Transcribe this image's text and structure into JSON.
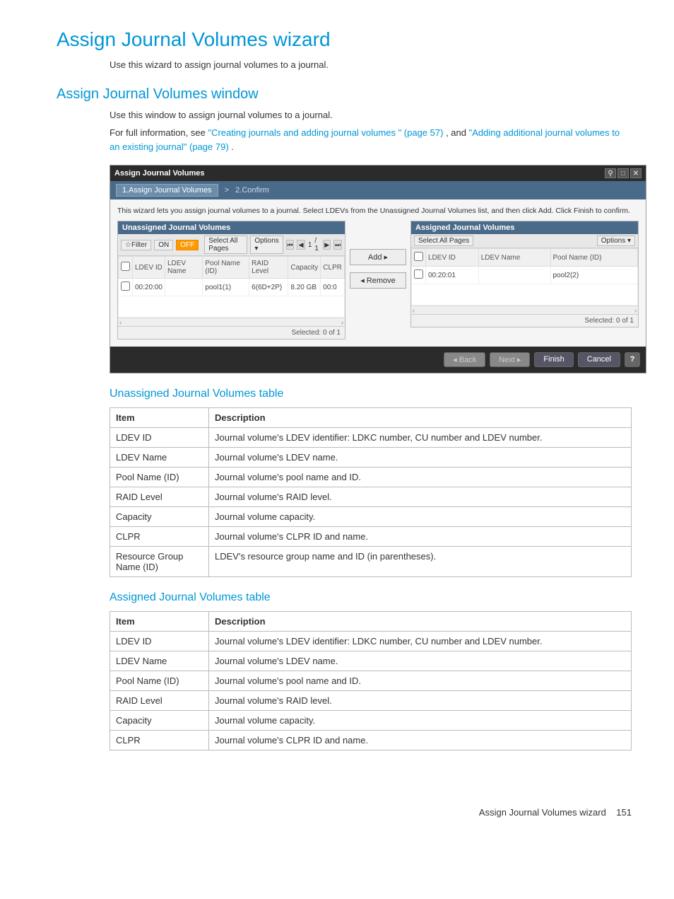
{
  "page": {
    "main_title": "Assign Journal Volumes wizard",
    "intro": "Use this wizard to assign journal volumes to a journal.",
    "section2_title": "Assign Journal Volumes window",
    "section2_intro": "Use this window to assign journal volumes to a journal.",
    "full_info_prefix": "For full information, see ",
    "link1": "\"Creating journals and adding journal volumes \" (page 57)",
    "mid_text": ", and ",
    "link2": "\"Adding additional journal volumes to an existing journal\" (page 79)",
    "end_punct": "."
  },
  "wizard": {
    "title": "Assign Journal Volumes",
    "breadcrumb_step1": "1.Assign Journal Volumes",
    "breadcrumb_sep": ">",
    "breadcrumb_step2": "2.Confirm",
    "instruction": "This wizard lets you assign journal volumes to a journal. Select LDEVs from the Unassigned Journal Volumes list, and then click Add. Click Finish to confirm.",
    "left_panel": {
      "header": "Unassigned Journal Volumes",
      "filter_label": "☆Filter",
      "on": "ON",
      "off": "OFF",
      "select_all": "Select All Pages",
      "options": "Options ▾",
      "page_cur": "1",
      "page_sep": "/ 1",
      "columns": [
        "LDEV ID",
        "LDEV Name",
        "Pool Name (ID)",
        "RAID Level",
        "Capacity",
        "CLPR"
      ],
      "row": [
        "00:20:00",
        "",
        "pool1(1)",
        "6(6D+2P)",
        "8.20 GB",
        "00:0"
      ],
      "selected": "Selected:  0   of  1"
    },
    "right_panel": {
      "header": "Assigned Journal Volumes",
      "select_all": "Select All Pages",
      "options": "Options ▾",
      "columns": [
        "LDEV ID",
        "LDEV Name",
        "Pool Name (ID)"
      ],
      "row": [
        "00:20:01",
        "",
        "pool2(2)"
      ],
      "selected": "Selected:  0   of  1"
    },
    "add_btn": "Add ▸",
    "remove_btn": "◂ Remove",
    "footer": {
      "back": "◂ Back",
      "next": "Next ▸",
      "finish": "Finish",
      "cancel": "Cancel",
      "help": "?"
    }
  },
  "tables": {
    "unassigned_title": "Unassigned Journal Volumes table",
    "assigned_title": "Assigned Journal Volumes table",
    "header_item": "Item",
    "header_desc": "Description",
    "unassigned_rows": [
      [
        "LDEV ID",
        "Journal volume's LDEV identifier: LDKC number, CU number and LDEV number."
      ],
      [
        "LDEV Name",
        "Journal volume's LDEV name."
      ],
      [
        "Pool Name (ID)",
        "Journal volume's pool name and ID."
      ],
      [
        "RAID Level",
        "Journal volume's RAID level."
      ],
      [
        "Capacity",
        "Journal volume capacity."
      ],
      [
        "CLPR",
        "Journal volume's CLPR ID and name."
      ],
      [
        "Resource Group Name (ID)",
        "LDEV's resource group name and ID (in parentheses)."
      ]
    ],
    "assigned_rows": [
      [
        "LDEV ID",
        "Journal volume's LDEV identifier: LDKC number, CU number and LDEV number."
      ],
      [
        "LDEV Name",
        "Journal volume's LDEV name."
      ],
      [
        "Pool Name (ID)",
        "Journal volume's pool name and ID."
      ],
      [
        "RAID Level",
        "Journal volume's RAID level."
      ],
      [
        "Capacity",
        "Journal volume capacity."
      ],
      [
        "CLPR",
        "Journal volume's CLPR ID and name."
      ]
    ]
  },
  "footer": {
    "text": "Assign Journal Volumes wizard",
    "page_no": "151"
  }
}
